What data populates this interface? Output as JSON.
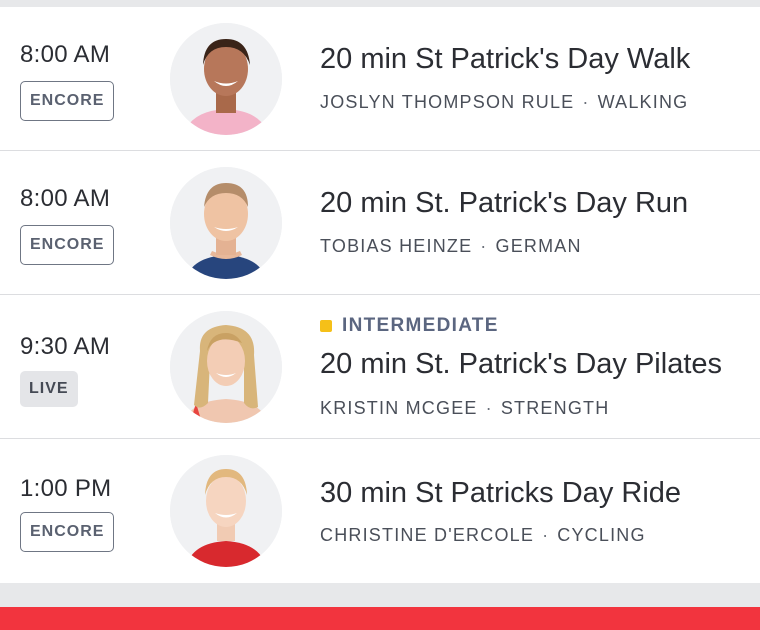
{
  "colors": {
    "accent_red": "#f2343e",
    "level_intermediate": "#f5c018"
  },
  "classes": [
    {
      "time": "8:00 AM",
      "badge": "ENCORE",
      "avatar_icon": "instructor-photo",
      "title": "20 min St Patrick's Day Walk",
      "instructor": "JOSLYN THOMPSON RULE",
      "separator": "·",
      "category": "WALKING"
    },
    {
      "time": "8:00 AM",
      "badge": "ENCORE",
      "avatar_icon": "instructor-photo",
      "title": "20 min St. Patrick's Day Run",
      "instructor": "TOBIAS HEINZE",
      "separator": "·",
      "category": "GERMAN"
    },
    {
      "time": "9:30 AM",
      "badge": "LIVE",
      "avatar_icon": "instructor-photo",
      "level": "INTERMEDIATE",
      "title": "20 min St. Patrick's Day Pilates",
      "instructor": "KRISTIN MCGEE",
      "separator": "·",
      "category": "STRENGTH"
    },
    {
      "time": "1:00 PM",
      "badge": "ENCORE",
      "avatar_icon": "instructor-photo",
      "title": "30 min St Patricks Day Ride",
      "instructor": "CHRISTINE D'ERCOLE",
      "separator": "·",
      "category": "CYCLING"
    }
  ]
}
